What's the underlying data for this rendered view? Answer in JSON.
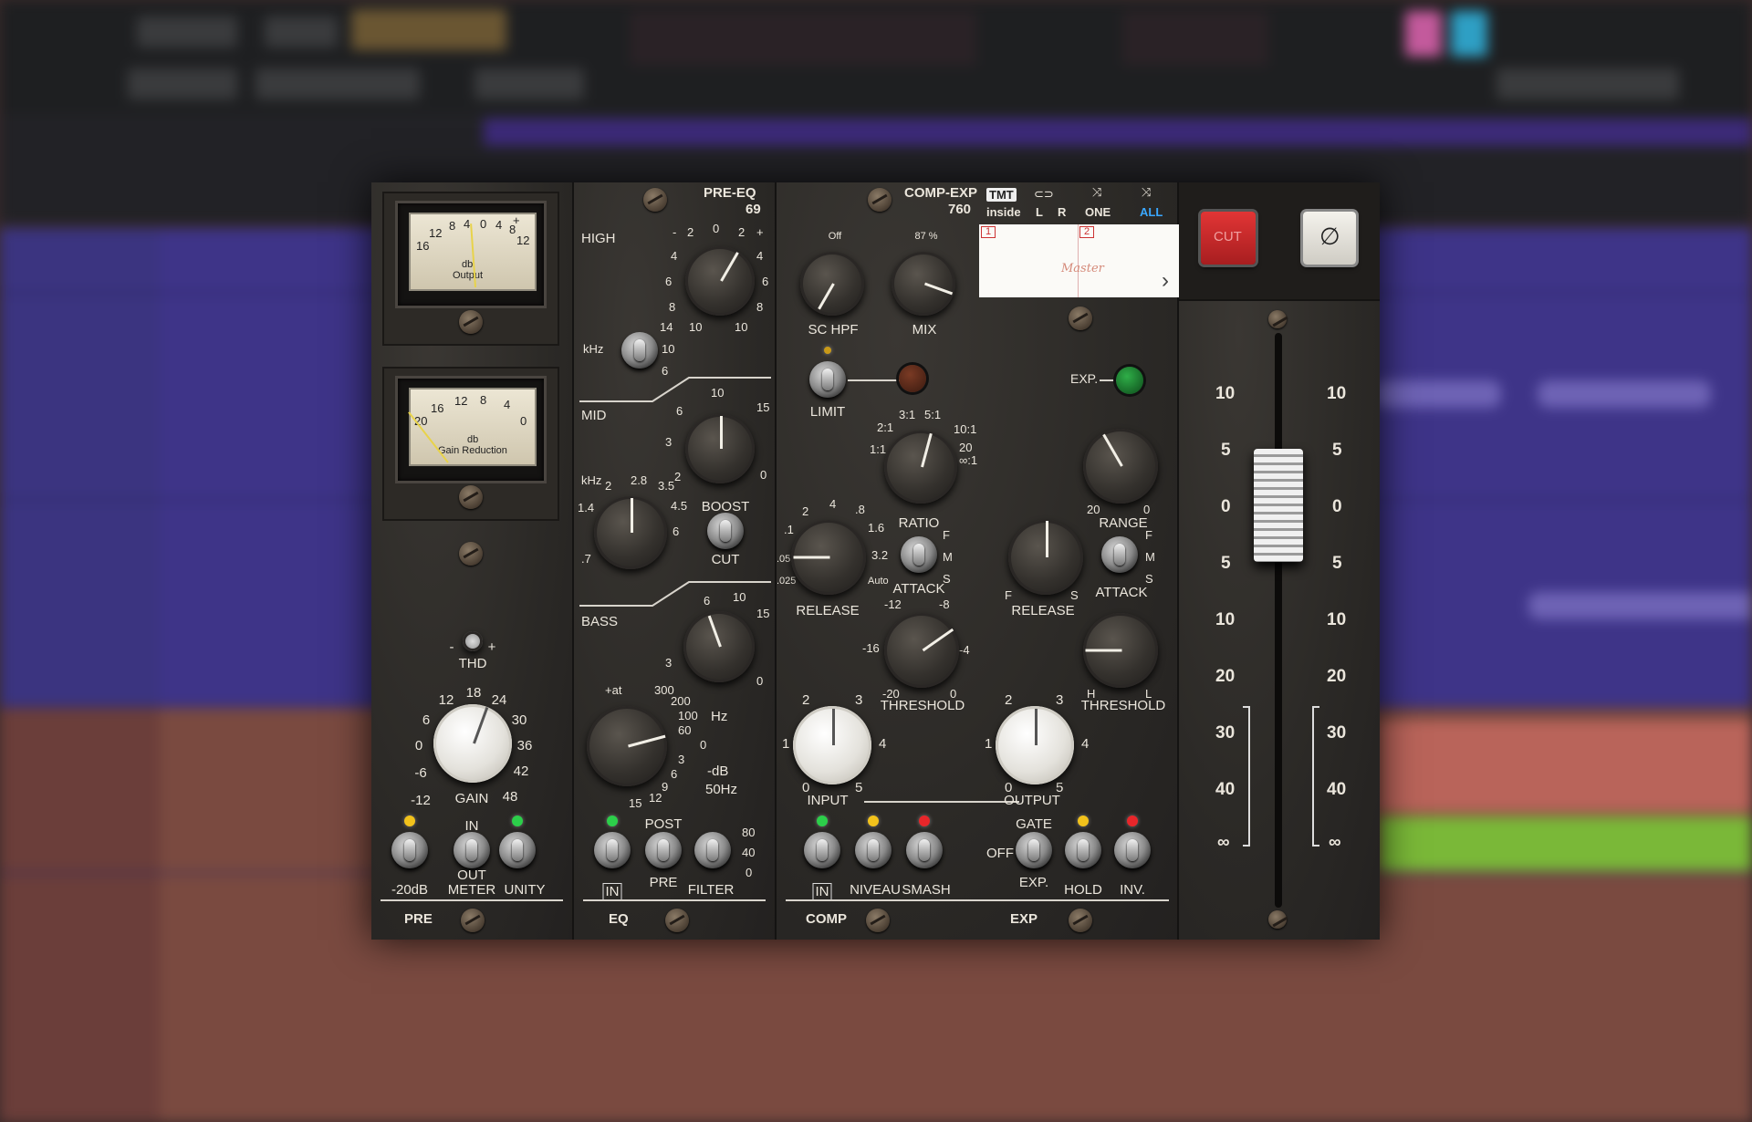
{
  "pre": {
    "meter1": {
      "scale": [
        "16",
        "12",
        "8",
        "4",
        "0",
        "4",
        "8",
        "12"
      ],
      "unit": "db",
      "caption": "Output",
      "plus": "+",
      "minus": "-"
    },
    "meter2": {
      "scale": [
        "20",
        "16",
        "12",
        "8",
        "4",
        "0"
      ],
      "unit": "db",
      "caption": "Gain Reduction"
    },
    "thd_label": "THD",
    "thd_minus": "-",
    "thd_plus": "+",
    "gain_label": "GAIN",
    "gain_scale": [
      "-12",
      "-6",
      "0",
      "6",
      "12",
      "18",
      "24",
      "30",
      "36",
      "42",
      "48"
    ],
    "sw_minus20": "-20dB",
    "sw_meter_top": "IN",
    "sw_meter_bot": "OUT",
    "sw_meter": "METER",
    "sw_unity": "UNITY",
    "section": "PRE"
  },
  "eq": {
    "title": "PRE-EQ",
    "model": "69",
    "high_label": "HIGH",
    "high_scale": [
      "-",
      "2",
      "0",
      "2",
      "+",
      "4",
      "4",
      "6",
      "6",
      "8",
      "8",
      "10",
      "10"
    ],
    "khz_label": "kHz",
    "high_freqs": [
      "14",
      "10",
      "6"
    ],
    "mid_label": "MID",
    "mid_scale": [
      "10",
      "6",
      "15",
      "3",
      "2",
      "0"
    ],
    "mid_khz_label": "kHz",
    "mid_freqs": [
      "2",
      "2.8",
      "3.5",
      "1.4",
      "4.5",
      ".7",
      "6"
    ],
    "boost": "BOOST",
    "cut": "CUT",
    "bass_label": "BASS",
    "bass_scale": [
      "6",
      "10",
      "15",
      "3",
      "0"
    ],
    "filter_att": "+at",
    "filter_scale": [
      "300",
      "200",
      "100",
      "60",
      "0",
      "3",
      "6",
      "9",
      "12",
      "15"
    ],
    "hz": "Hz",
    "db_label": "-dB",
    "hz50": "50Hz",
    "sw_in": "IN",
    "sw_post": "POST",
    "sw_pre": "PRE",
    "sw_filter": "FILTER",
    "filter_values": [
      "80",
      "40",
      "0"
    ],
    "section": "EQ"
  },
  "comp": {
    "title": "COMP-EXP",
    "model": "760",
    "schpf_label": "SC HPF",
    "schpf_off": "Off",
    "mix_label": "MIX",
    "mix_value": "87 %",
    "limit_label": "LIMIT",
    "ratio_label": "RATIO",
    "ratio_scale": [
      "2:1",
      "3:1",
      "5:1",
      "1:1",
      "10:1",
      "20",
      "∞:1"
    ],
    "release_label": "RELEASE",
    "release_scale": [
      "2",
      "4",
      ".8",
      ".1",
      "1.6",
      ".05",
      "3.2",
      ".025",
      "Auto"
    ],
    "attack_label": "ATTACK",
    "attack_fms": [
      "F",
      "M",
      "S"
    ],
    "threshold_label": "THRESHOLD",
    "threshold_scale": [
      "-12",
      "-8",
      "-16",
      "-4",
      "-20",
      "0"
    ],
    "input_label": "INPUT",
    "input_scale": [
      "2",
      "3",
      "1",
      "4",
      "0",
      "5"
    ],
    "sw_in": "IN",
    "sw_niveau": "NIVEAU",
    "sw_smash": "SMASH",
    "section": "COMP"
  },
  "exp": {
    "exp_label": "EXP.",
    "range_label": "RANGE",
    "range_scale": [
      "20",
      "0"
    ],
    "release_label": "RELEASE",
    "release_fs": [
      "F",
      "S"
    ],
    "attack_label": "ATTACK",
    "attack_fms": [
      "F",
      "M",
      "S"
    ],
    "threshold_label": "THRESHOLD",
    "threshold_hl": [
      "H",
      "L"
    ],
    "output_label": "OUTPUT",
    "output_scale": [
      "2",
      "3",
      "1",
      "4",
      "0",
      "5"
    ],
    "gate_label": "GATE",
    "off_label": "OFF",
    "exp_sw": "EXP.",
    "hold_label": "HOLD",
    "inv_label": "INV.",
    "section": "EXP"
  },
  "header": {
    "tmt": "TMT",
    "tmt_inside": "inside",
    "l": "L",
    "r": "R",
    "one": "ONE",
    "all": "ALL",
    "slot1": "1",
    "slot2": "2",
    "preset_name": "Master",
    "next": "›"
  },
  "fader": {
    "cut_label": "CUT",
    "phase_label": "∅",
    "scale": [
      "10",
      "5",
      "0",
      "5",
      "10",
      "20",
      "30",
      "40",
      "∞"
    ]
  },
  "colors": {
    "led_yellow": "#f2c21b",
    "led_green": "#2ccf4a",
    "led_red": "#e8262a",
    "cut_red": "#d4282a",
    "all_blue": "#3aa8ff"
  }
}
